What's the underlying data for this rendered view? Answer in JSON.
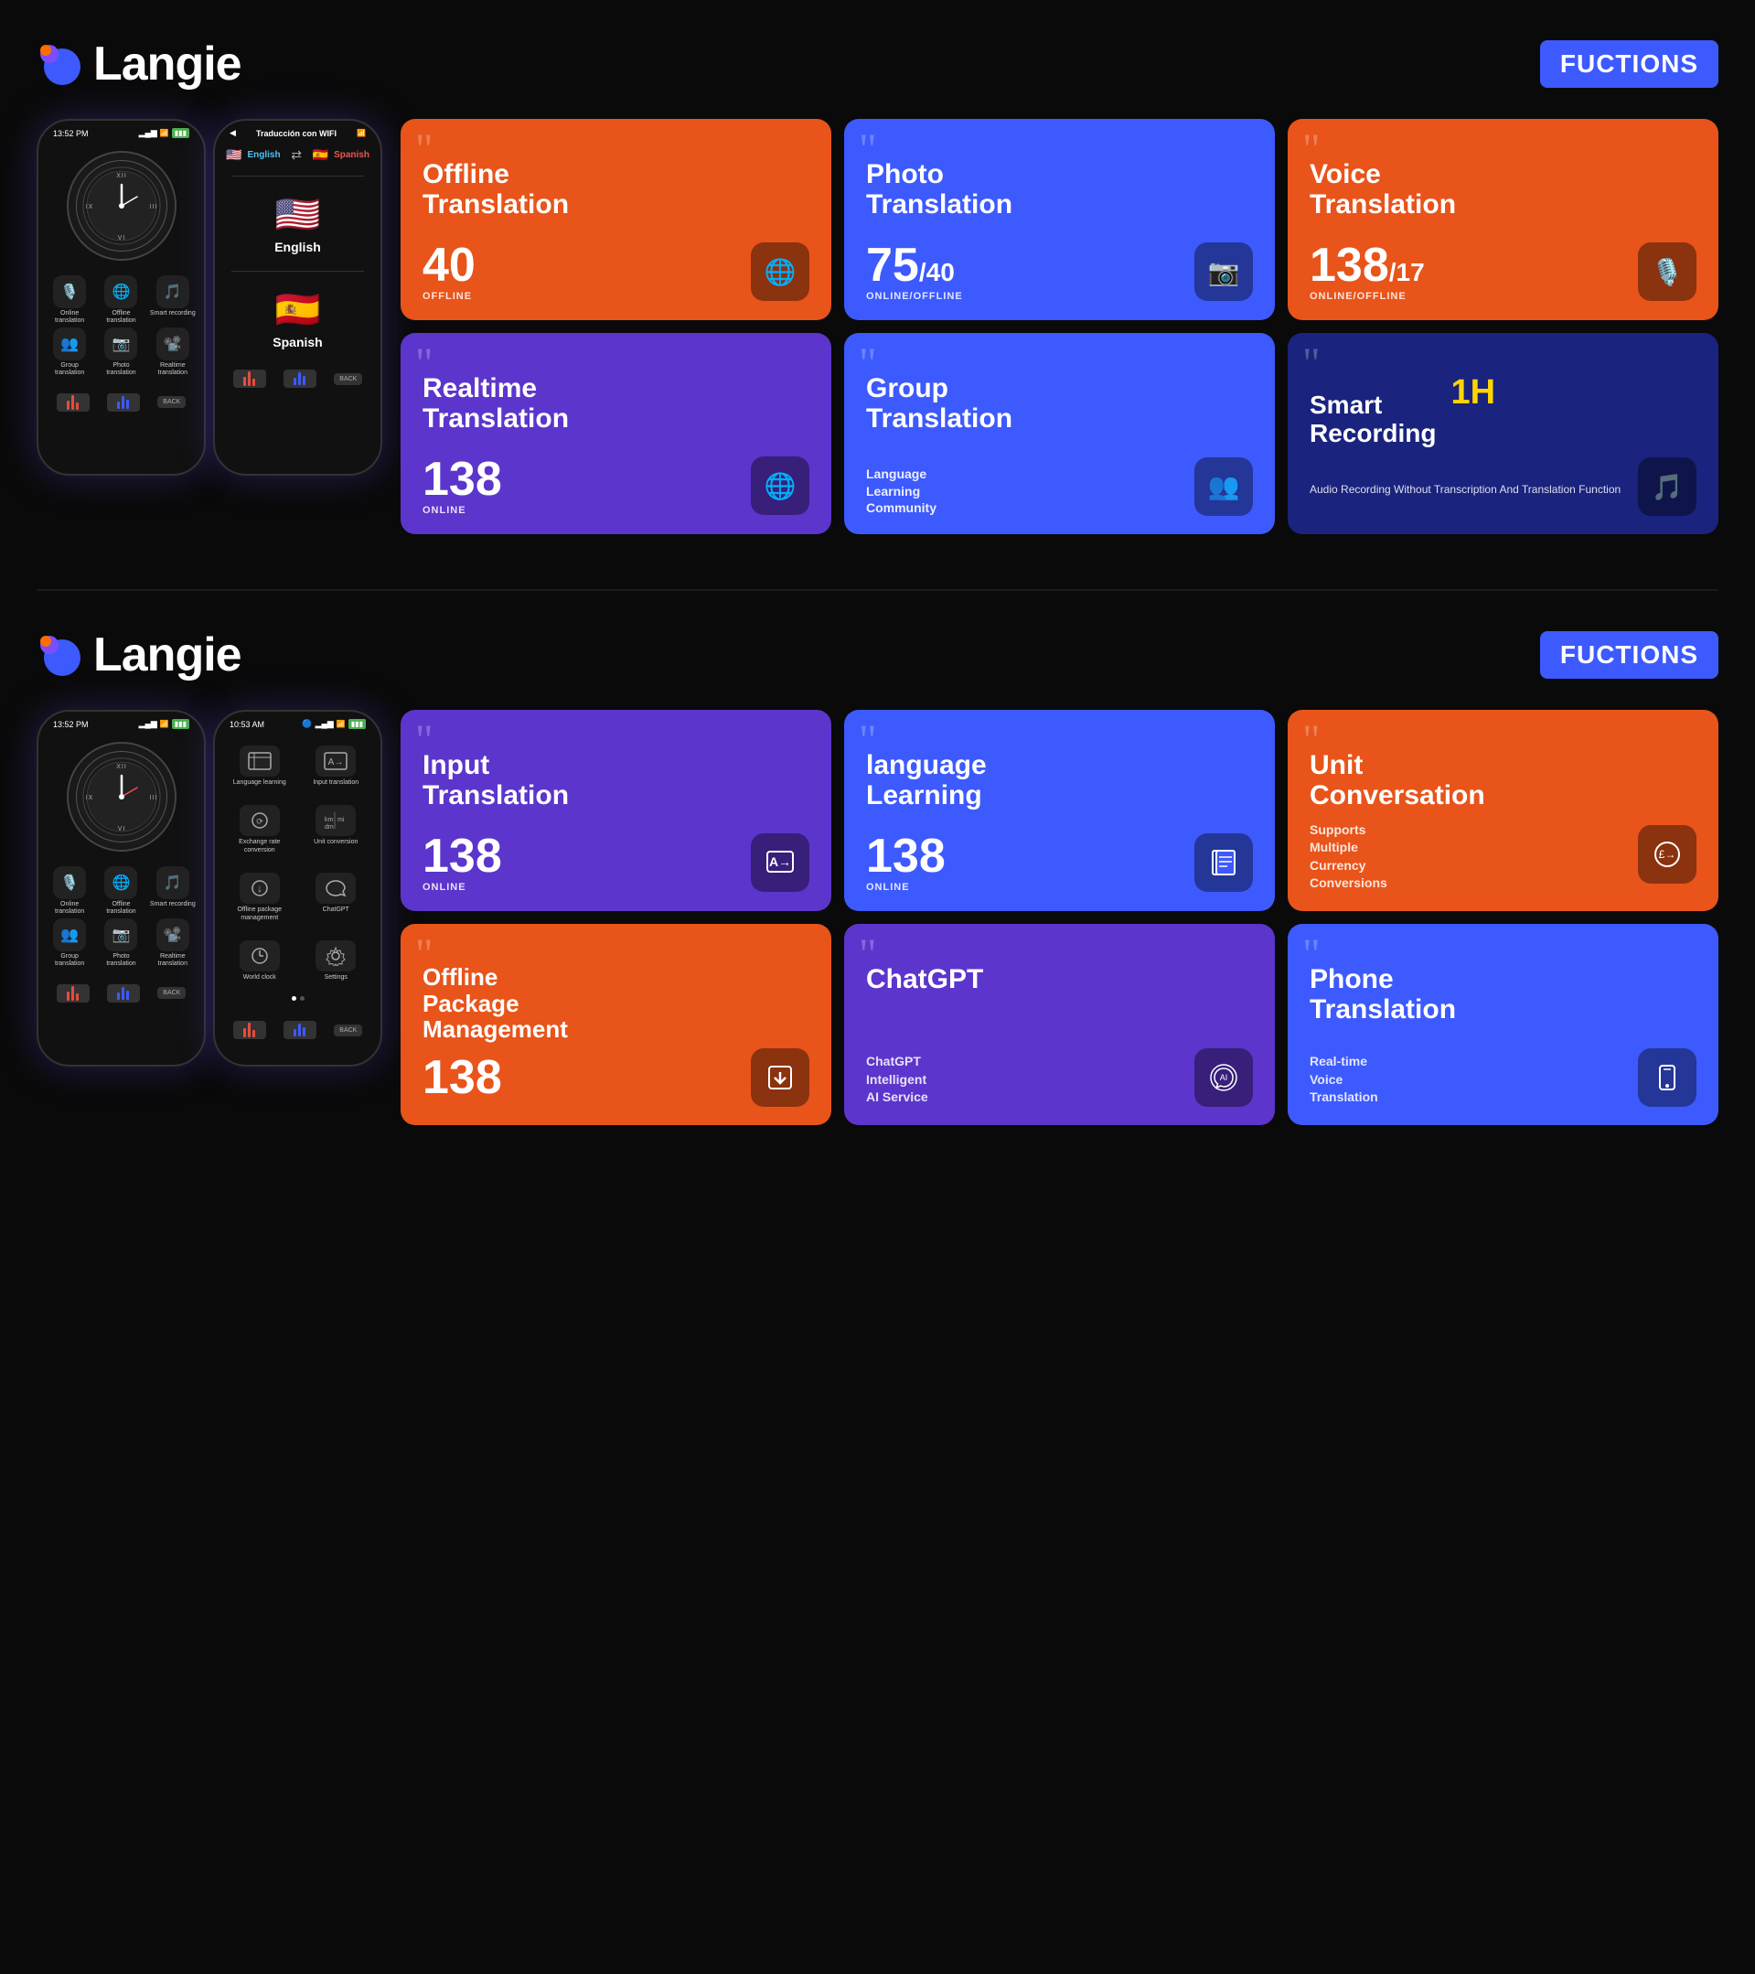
{
  "sections": [
    {
      "id": "section1",
      "logo": "Langie",
      "logo_icon": "🔵",
      "functions_label": "FUCTIONS",
      "cards": [
        {
          "id": "offline-translation",
          "color": "card-orange",
          "title": "Offline Translation",
          "number": "40",
          "number2": null,
          "status": "OFFLINE",
          "icon": "🌐",
          "desc": null
        },
        {
          "id": "photo-translation",
          "color": "card-blue",
          "title": "Photo Translation",
          "number": "75",
          "number2": "40",
          "status": "ONLINE/OFFLINE",
          "icon": "📷",
          "desc": null
        },
        {
          "id": "voice-translation",
          "color": "card-orange",
          "title": "Voice Translation",
          "number": "138",
          "number2": "17",
          "status": "ONLINE/OFFLINE",
          "icon": "🎙️",
          "desc": null
        },
        {
          "id": "realtime-translation",
          "color": "card-purple",
          "title": "Realtime Translation",
          "number": "138",
          "number2": null,
          "status": "ONLINE",
          "icon": "🌐",
          "desc": null
        },
        {
          "id": "group-translation",
          "color": "card-blue",
          "title": "Group Translation",
          "number": null,
          "number2": null,
          "status": null,
          "icon": "👥",
          "desc": "Language Learning Community"
        },
        {
          "id": "smart-recording",
          "color": "card-dark-blue",
          "title": "Smart Recording",
          "number": null,
          "number2": null,
          "status": null,
          "icon": "🎵",
          "badge": "1H",
          "desc": "Audio Recording Without Transcription And Translation Function"
        }
      ],
      "phone1": {
        "time": "13:52 PM",
        "apps": [
          {
            "icon": "🎙️",
            "label": "Online translation"
          },
          {
            "icon": "🌐",
            "label": "Offline translation"
          },
          {
            "icon": "🎵",
            "label": "Smart recording"
          },
          {
            "icon": "👥",
            "label": "Group translation"
          },
          {
            "icon": "📷",
            "label": "Photo translation"
          },
          {
            "icon": "📽️",
            "label": "Realtime translation"
          }
        ]
      },
      "phone2": {
        "time": "Traducción con WIFI",
        "lang1": "English",
        "lang1_flag": "🇺🇸",
        "lang2": "Spanish",
        "lang2_flag": "🇪🇸"
      }
    },
    {
      "id": "section2",
      "logo": "Langie",
      "logo_icon": "🔵",
      "functions_label": "FUCTIONS",
      "cards": [
        {
          "id": "input-translation",
          "color": "card-purple",
          "title": "Input Translation",
          "number": "138",
          "number2": null,
          "status": "ONLINE",
          "icon": "🔤",
          "desc": null
        },
        {
          "id": "language-learning",
          "color": "card-blue",
          "title": "language Learning",
          "number": "138",
          "number2": null,
          "status": "ONLINE",
          "icon": "📚",
          "desc": null
        },
        {
          "id": "unit-conversation",
          "color": "card-orange",
          "title": "Unit Conversation",
          "number": null,
          "number2": null,
          "status": null,
          "icon": "💱",
          "desc": "Supports Multiple Currency Conversions"
        },
        {
          "id": "offline-package",
          "color": "card-orange",
          "title": "Offline Package Management",
          "number": "138",
          "number2": null,
          "status": null,
          "icon": "⬇️",
          "desc": null
        },
        {
          "id": "chatgpt",
          "color": "card-purple",
          "title": "ChatGPT",
          "number": null,
          "number2": null,
          "status": null,
          "icon": "🤖",
          "desc": "ChatGPT Intelligent AI Service"
        },
        {
          "id": "phone-translation",
          "color": "card-blue",
          "title": "Phone Translation",
          "number": null,
          "number2": null,
          "status": null,
          "icon": "📱",
          "desc": "Real-time Voice Translation"
        }
      ],
      "phone1": {
        "time": "13:52 PM",
        "apps": [
          {
            "icon": "🎙️",
            "label": "Online translation"
          },
          {
            "icon": "🌐",
            "label": "Offline translation"
          },
          {
            "icon": "🎵",
            "label": "Smart recording"
          },
          {
            "icon": "👥",
            "label": "Group translation"
          },
          {
            "icon": "📷",
            "label": "Photo translation"
          },
          {
            "icon": "📽️",
            "label": "Realtime translation"
          }
        ]
      },
      "phone2": {
        "time": "10:53 AM",
        "menu": [
          {
            "icon": "📚",
            "label": "Language learning"
          },
          {
            "icon": "🔤",
            "label": "Input translation"
          },
          {
            "icon": "💱",
            "label": "Exchange rate conversion"
          },
          {
            "icon": "📏",
            "label": "Unit conversion"
          },
          {
            "icon": "📦",
            "label": "Offline package management"
          },
          {
            "icon": "🤖",
            "label": "ChatGPT"
          },
          {
            "icon": "🕐",
            "label": "World clock"
          },
          {
            "icon": "⚙️",
            "label": "Settings"
          }
        ]
      }
    }
  ]
}
